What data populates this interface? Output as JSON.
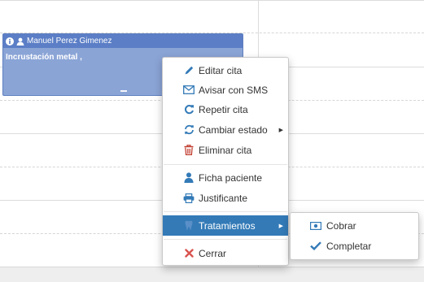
{
  "appointment": {
    "patient_name": "Manuel Perez Gimenez",
    "treatment": "Incrustación metal ,",
    "header_icons": [
      "info-icon",
      "user-icon"
    ]
  },
  "context_menu": {
    "items": [
      {
        "label": "Editar cita",
        "icon": "pencil-icon"
      },
      {
        "label": "Avisar con SMS",
        "icon": "envelope-icon"
      },
      {
        "label": "Repetir cita",
        "icon": "repeat-icon"
      },
      {
        "label": "Cambiar estado",
        "icon": "refresh-icon",
        "has_submenu": true
      },
      {
        "label": "Eliminar cita",
        "icon": "trash-icon"
      },
      {
        "label": "Ficha paciente",
        "icon": "user-icon"
      },
      {
        "label": "Justificante",
        "icon": "print-icon"
      },
      {
        "label": "Tratamientos",
        "icon": "tooth-icon",
        "has_submenu": true,
        "highlighted": true
      },
      {
        "label": "Cerrar",
        "icon": "close-icon"
      }
    ]
  },
  "submenu": {
    "items": [
      {
        "label": "Cobrar",
        "icon": "money-icon"
      },
      {
        "label": "Completar",
        "icon": "check-icon"
      }
    ]
  },
  "colors": {
    "accent": "#337ab7",
    "appointment_bg": "#8aa4d6",
    "appointment_header": "#5b7ec6",
    "delete_icon": "#c0392b",
    "close_icon": "#d9534f"
  }
}
